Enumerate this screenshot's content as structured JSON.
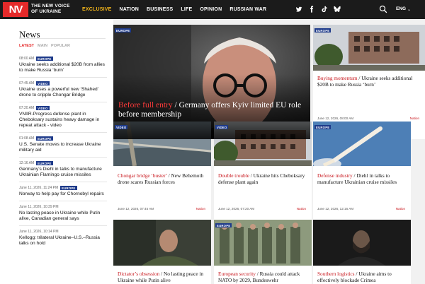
{
  "header": {
    "logo": "NV",
    "logo_text": "THE NEW VOICE OF UKRAINE",
    "nav": [
      "EXCLUSIVE",
      "NATION",
      "BUSINESS",
      "LIFE",
      "OPINION",
      "RUSSIAN WAR"
    ],
    "lang": "ENG",
    "accent": "#f2b51b",
    "brand": "#e52a2a"
  },
  "sidebar": {
    "title": "News",
    "tabs": [
      "LATEST",
      "MAIN",
      "POPULAR"
    ],
    "items": [
      {
        "time": "08:00 AM",
        "tag": "EUROPE",
        "headline": "Ukraine seeks additional $20B from allies to make Russia ‘burn’"
      },
      {
        "time": "07:45 AM",
        "tag": "VIDEO",
        "headline": "Ukraine uses a powerful new ‘Shahed’ drone to cripple Chongar Bridge"
      },
      {
        "time": "07:20 AM",
        "tag": "VIDEO",
        "headline": "VNIIR-Progress defense plant in Cheboksary sustains heavy damage in repeat attack - video"
      },
      {
        "time": "01:08 AM",
        "tag": "EUROPE",
        "headline": "U.S. Senate moves to increase Ukraine military aid"
      },
      {
        "time": "12:16 AM",
        "tag": "EUROPE",
        "headline": "Germany’s Diehl in talks to manufacture Ukrainian Flamingo cruise missiles"
      },
      {
        "time": "June 11, 2026, 11:24 PM",
        "tag": "EUROPE",
        "headline": "Norway to help pay for Chornobyl repairs"
      },
      {
        "time": "June 11, 2026, 10:39 PM",
        "tag": "",
        "headline": "No lasting peace in Ukraine while Putin alive, Canadian general says"
      },
      {
        "time": "June 11, 2026, 10:14 PM",
        "tag": "",
        "headline": "Kellogg: trilateral Ukraine–U.S.–Russia talks on hold"
      }
    ]
  },
  "hero": {
    "label": "EUROPE",
    "kicker": "Before full entry",
    "title": "Germany offers Kyiv limited EU role before membership"
  },
  "cards": [
    {
      "label": "EUROPE",
      "kicker": "Buying momentum",
      "title": "Ukraine seeks additional $20B to make Russia ‘burn’",
      "date": "June 12, 2026, 08:00 AM",
      "section": "Nation"
    },
    {
      "label": "VIDEO",
      "kicker": "Chongar bridge ‘buster’",
      "title": "New Behemoth drone scares Russian forces",
      "date": "June 12, 2026, 07:45 AM",
      "section": "Nation"
    },
    {
      "label": "VIDEO",
      "kicker": "Double trouble",
      "title": "Ukraine hits Cheboksary defense plant again",
      "date": "June 12, 2026, 07:20 AM",
      "section": "Nation"
    },
    {
      "label": "EUROPE",
      "kicker": "Defense industry",
      "title": "Diehl in talks to manufacture Ukrainian cruise missiles",
      "date": "June 12, 2026, 12:16 AM",
      "section": "Nation"
    },
    {
      "label": "",
      "kicker": "Dictator’s obsession",
      "title": "No lasting peace in Ukraine while Putin alive",
      "date": "",
      "section": ""
    },
    {
      "label": "EUROPE",
      "kicker": "European security",
      "title": "Russia could attack NATO by 2029, Bundeswehr",
      "date": "",
      "section": ""
    },
    {
      "label": "",
      "kicker": "Southern logistics",
      "title": "Ukraine aims to effectively blockade Crimea",
      "date": "",
      "section": ""
    }
  ]
}
